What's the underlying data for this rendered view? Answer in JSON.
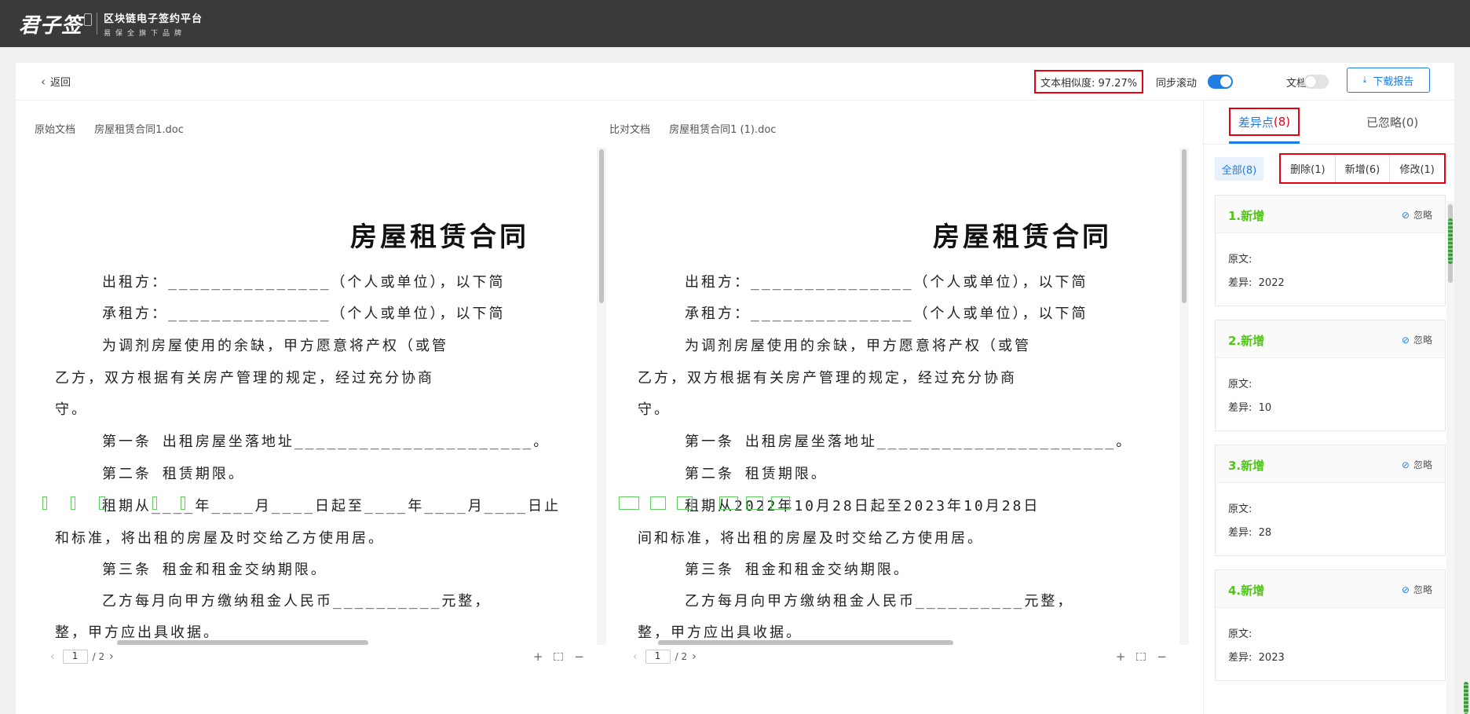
{
  "brand": {
    "name": "君子签",
    "tagline": "区块链电子签约平台",
    "sub": "易保全旗下品牌"
  },
  "toolbar": {
    "back_label": "返回",
    "similarity": "文本相似度: 97.27%",
    "sync_label": "同步滚动",
    "sync_on": true,
    "contrast_label": "文档对调",
    "contrast_on": false,
    "download_label": "下载报告"
  },
  "left_doc": {
    "header_label": "原始文档",
    "filename": "房屋租赁合同1.doc",
    "title": "房屋租赁合同",
    "lines": [
      "出租方：_______________（个人或单位），以下简",
      "承租方：_______________（个人或单位），以下简",
      "为调剂房屋使用的余缺，甲方愿意将产权（或管",
      "乙方，双方根据有关房产管理的规定，经过充分协商",
      "守。",
      "第一条 出租房屋坐落地址______________________。",
      "第二条 租赁期限。",
      "租期从____年____月____日起至____年____月____日止",
      "和标准，将出租的房屋及时交给乙方使用居。",
      "第三条 租金和租金交纳期限。",
      "乙方每月向甲方缴纳租金人民币__________元整，",
      "整，甲方应出具收据。"
    ],
    "page_current": "1",
    "page_total": "/ 2"
  },
  "right_doc": {
    "header_label": "比对文档",
    "filename": "房屋租赁合同1 (1).doc",
    "title": "房屋租赁合同",
    "lines": [
      "出租方：_______________（个人或单位），以下简",
      "承租方：_______________（个人或单位），以下简",
      "为调剂房屋使用的余缺，甲方愿意将产权（或管",
      "乙方，双方根据有关房产管理的规定，经过充分协商",
      "守。",
      "第一条 出租房屋坐落地址______________________。",
      "第二条 租赁期限。",
      "租期从2022年10月28日起至2023年10月28日",
      "间和标准，将出租的房屋及时交给乙方使用居。",
      "第三条 租金和租金交纳期限。",
      "乙方每月向甲方缴纳租金人民币__________元整，",
      "整，甲方应出具收据。"
    ],
    "page_current": "1",
    "page_total": "/ 2"
  },
  "sidebar": {
    "tab_diff_label": "差异点",
    "tab_diff_count": "(8)",
    "tab_ignored": "已忽略(0)",
    "filters": {
      "all": "全部(8)",
      "delete": "删除(1)",
      "add": "新增(6)",
      "modify": "修改(1)"
    },
    "cards": [
      {
        "title": "1.新增",
        "ignore": "忽略",
        "orig_label": "原文:",
        "diff_label": "差异:",
        "diff_value": "2022"
      },
      {
        "title": "2.新增",
        "ignore": "忽略",
        "orig_label": "原文:",
        "diff_label": "差异:",
        "diff_value": "10"
      },
      {
        "title": "3.新增",
        "ignore": "忽略",
        "orig_label": "原文:",
        "diff_label": "差异:",
        "diff_value": "28"
      },
      {
        "title": "4.新增",
        "ignore": "忽略",
        "orig_label": "原文:",
        "diff_label": "差异:",
        "diff_value": "2023"
      }
    ]
  },
  "colors": {
    "accent": "#1e7de3",
    "highlight_border": "#e60012",
    "added": "#52c41a"
  },
  "icons": {
    "back": "chevron-left-icon",
    "download": "download-icon",
    "ignore": "eye-off-icon",
    "zoom_in": "plus-icon",
    "zoom_fit": "fit-screen-icon",
    "zoom_out": "minus-icon"
  }
}
